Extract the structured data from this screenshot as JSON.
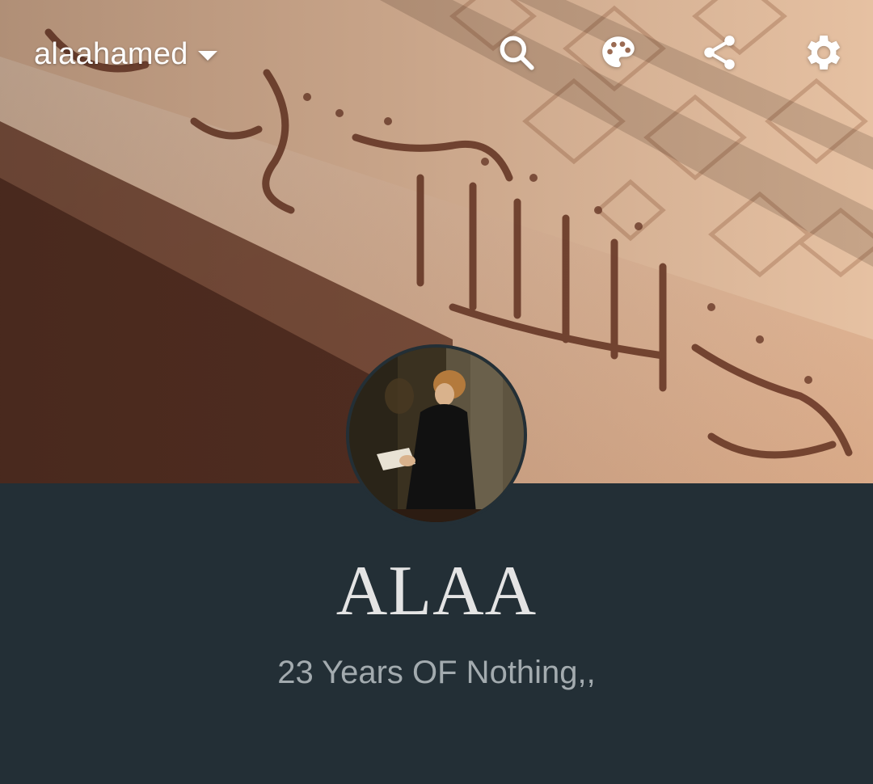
{
  "topbar": {
    "blog_name": "alaahamed",
    "icons": {
      "search": "search-icon",
      "palette": "palette-icon",
      "share": "share-icon",
      "settings": "gear-icon"
    }
  },
  "profile": {
    "title": "ALAA",
    "description": "23 Years OF Nothing,,"
  },
  "colors": {
    "panel_background": "#232f36",
    "title_text": "#e4e4e4",
    "description_text": "#a3abaf",
    "icon": "#ffffff"
  }
}
